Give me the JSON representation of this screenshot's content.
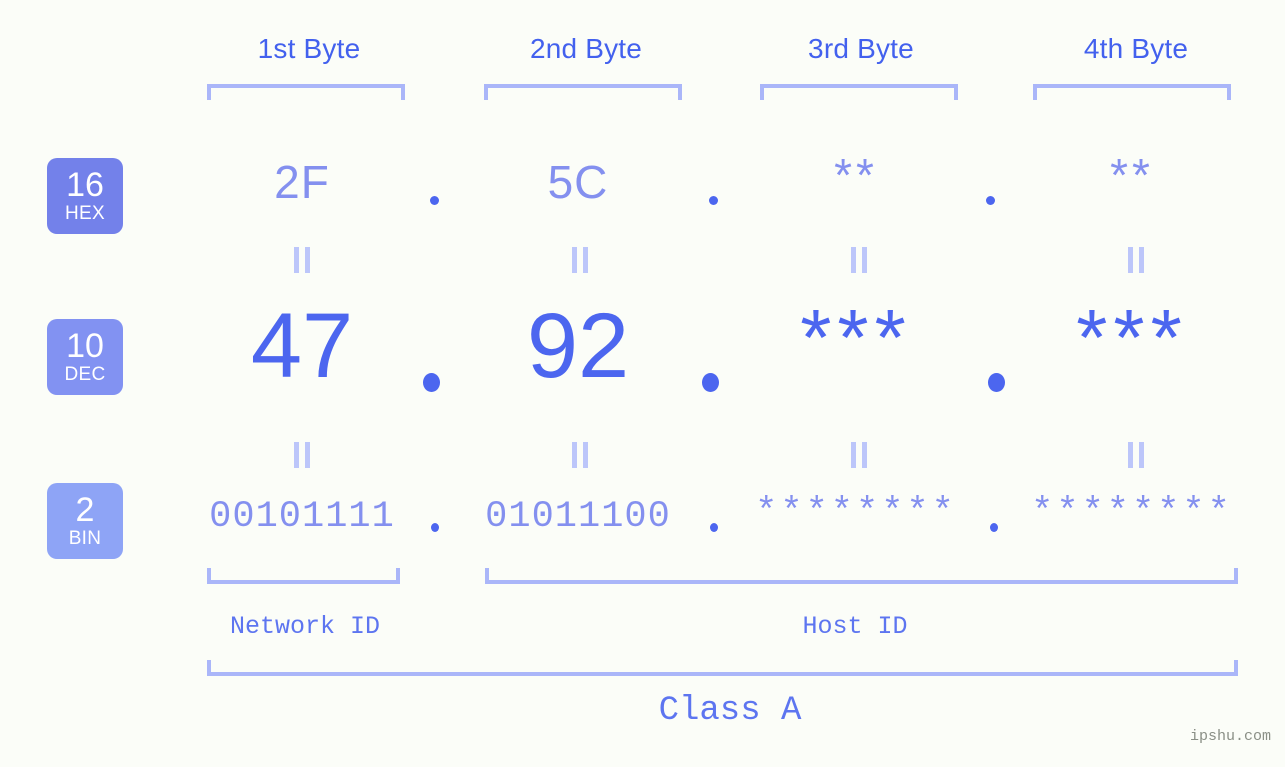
{
  "page": {
    "background_color": "#fbfdf8",
    "accent_strong": "#4361ee",
    "accent_mid": "#4c66ef",
    "accent_light": "#8490ef",
    "bracket_color": "#aab6f9",
    "watermark": "ipshu.com"
  },
  "byte_headers": [
    {
      "label": "1st Byte"
    },
    {
      "label": "2nd Byte"
    },
    {
      "label": "3rd Byte"
    },
    {
      "label": "4th Byte"
    }
  ],
  "rows": [
    {
      "badge_number": "16",
      "badge_name": "HEX",
      "badge_color": "#7381ea",
      "values": [
        "2F",
        "5C",
        "**",
        "**"
      ],
      "separator": "."
    },
    {
      "badge_number": "10",
      "badge_name": "DEC",
      "badge_color": "#8292f2",
      "values": [
        "47",
        "92",
        "***",
        "***"
      ],
      "separator": "."
    },
    {
      "badge_number": "2",
      "badge_name": "BIN",
      "badge_color": "#8ea4f6",
      "values": [
        "00101111",
        "01011100",
        "********",
        "********"
      ],
      "separator": "."
    }
  ],
  "equals_marks": {
    "glyph": "||",
    "count_per_row_gap": 4
  },
  "id_sections": [
    {
      "label": "Network ID"
    },
    {
      "label": "Host ID"
    }
  ],
  "class_section": {
    "label": "Class A"
  }
}
